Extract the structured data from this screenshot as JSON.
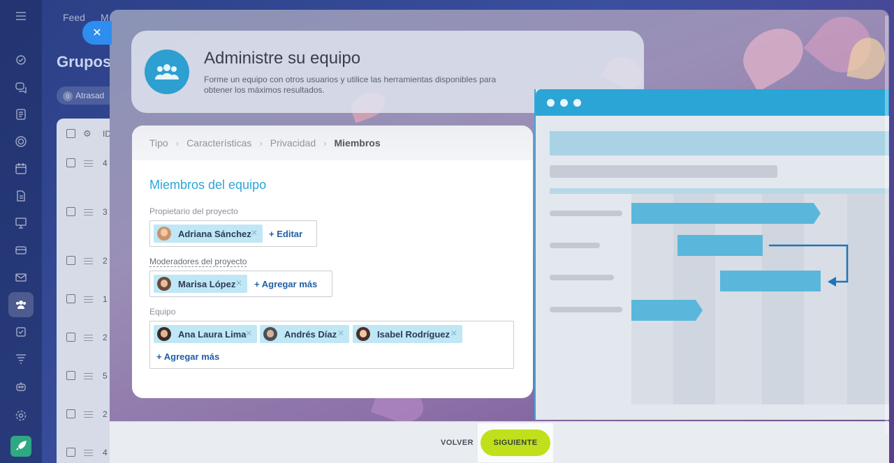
{
  "background": {
    "tabs": [
      "Feed",
      "M"
    ],
    "page_title": "Grupos",
    "filter_chip": {
      "count": "0",
      "label": "Atrasad"
    },
    "table_header": "ID",
    "row_ids": [
      "4",
      "3",
      "2",
      "1",
      "2",
      "5",
      "2",
      "4"
    ]
  },
  "header": {
    "title": "Administre su equipo",
    "description": "Forme un equipo con otros usuarios y utilice las herramientas disponibles para obtener los máximos resultados."
  },
  "wizard": {
    "breadcrumbs": [
      "Tipo",
      "Características",
      "Privacidad",
      "Miembros"
    ],
    "section_title": "Miembros del equipo",
    "owner": {
      "label": "Propietario del proyecto",
      "members": [
        "Adriana Sánchez"
      ],
      "action": "Editar"
    },
    "moderators": {
      "label": "Moderadores del proyecto",
      "members": [
        "Marisa López"
      ],
      "action": "Agregar más"
    },
    "team": {
      "label": "Equipo",
      "members": [
        "Ana Laura Lima",
        "Andrés Díaz",
        "Isabel Rodríguez"
      ],
      "action": "Agregar más"
    }
  },
  "footer": {
    "back_label": "VOLVER",
    "next_label": "SIGUIENTE"
  },
  "colors": {
    "accent": "#2aa6d8",
    "next_button": "#bfe01a",
    "tag_bg": "#bfe7f6",
    "link": "#1f5fa5"
  }
}
